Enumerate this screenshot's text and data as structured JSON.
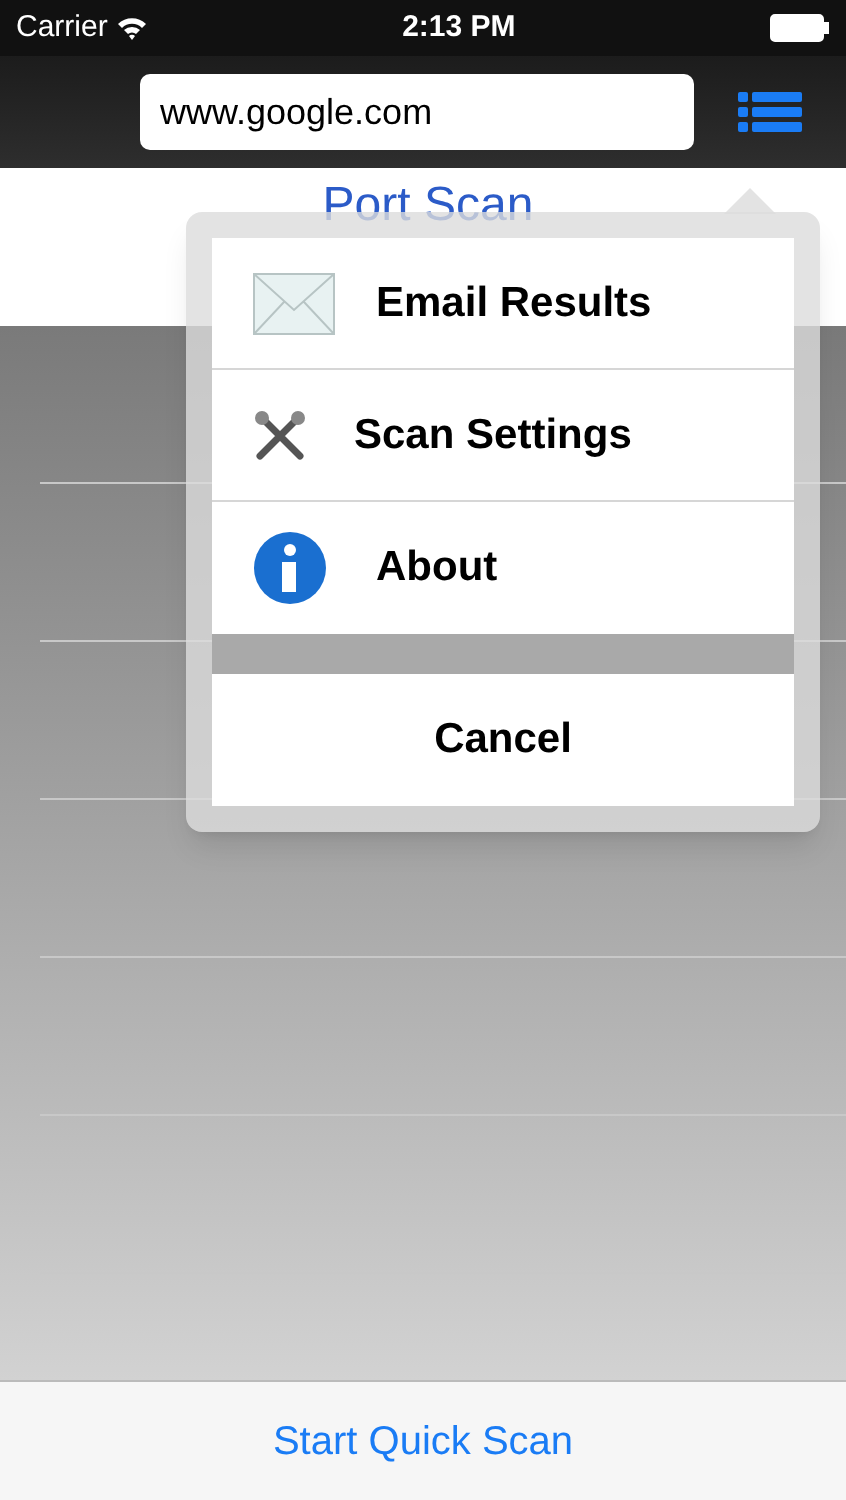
{
  "status_bar": {
    "carrier": "Carrier",
    "time": "2:13 PM"
  },
  "nav_bar": {
    "address": "www.google.com"
  },
  "title": "Port Scan",
  "menu": {
    "items": [
      {
        "kind": "email",
        "label": "Email Results"
      },
      {
        "kind": "settings",
        "label": "Scan Settings"
      },
      {
        "kind": "about",
        "label": "About"
      }
    ],
    "cancel": "Cancel"
  },
  "bottom_button": "Start Quick Scan"
}
